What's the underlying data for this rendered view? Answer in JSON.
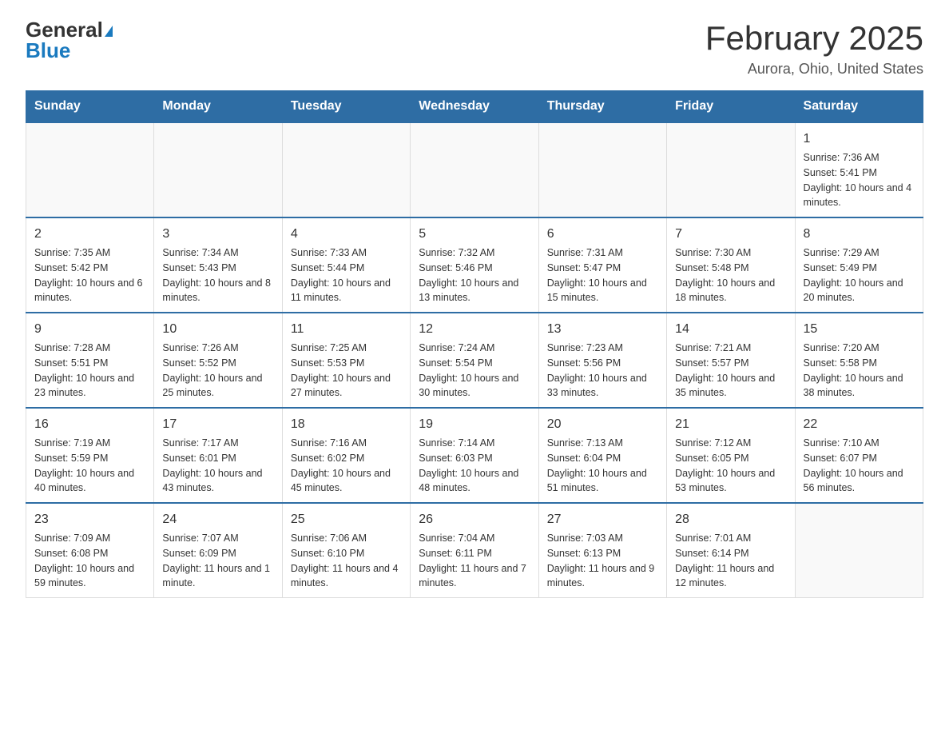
{
  "header": {
    "logo_general": "General",
    "logo_blue": "Blue",
    "month_title": "February 2025",
    "location": "Aurora, Ohio, United States"
  },
  "weekdays": [
    "Sunday",
    "Monday",
    "Tuesday",
    "Wednesday",
    "Thursday",
    "Friday",
    "Saturday"
  ],
  "weeks": [
    [
      {
        "day": "",
        "info": ""
      },
      {
        "day": "",
        "info": ""
      },
      {
        "day": "",
        "info": ""
      },
      {
        "day": "",
        "info": ""
      },
      {
        "day": "",
        "info": ""
      },
      {
        "day": "",
        "info": ""
      },
      {
        "day": "1",
        "info": "Sunrise: 7:36 AM\nSunset: 5:41 PM\nDaylight: 10 hours and 4 minutes."
      }
    ],
    [
      {
        "day": "2",
        "info": "Sunrise: 7:35 AM\nSunset: 5:42 PM\nDaylight: 10 hours and 6 minutes."
      },
      {
        "day": "3",
        "info": "Sunrise: 7:34 AM\nSunset: 5:43 PM\nDaylight: 10 hours and 8 minutes."
      },
      {
        "day": "4",
        "info": "Sunrise: 7:33 AM\nSunset: 5:44 PM\nDaylight: 10 hours and 11 minutes."
      },
      {
        "day": "5",
        "info": "Sunrise: 7:32 AM\nSunset: 5:46 PM\nDaylight: 10 hours and 13 minutes."
      },
      {
        "day": "6",
        "info": "Sunrise: 7:31 AM\nSunset: 5:47 PM\nDaylight: 10 hours and 15 minutes."
      },
      {
        "day": "7",
        "info": "Sunrise: 7:30 AM\nSunset: 5:48 PM\nDaylight: 10 hours and 18 minutes."
      },
      {
        "day": "8",
        "info": "Sunrise: 7:29 AM\nSunset: 5:49 PM\nDaylight: 10 hours and 20 minutes."
      }
    ],
    [
      {
        "day": "9",
        "info": "Sunrise: 7:28 AM\nSunset: 5:51 PM\nDaylight: 10 hours and 23 minutes."
      },
      {
        "day": "10",
        "info": "Sunrise: 7:26 AM\nSunset: 5:52 PM\nDaylight: 10 hours and 25 minutes."
      },
      {
        "day": "11",
        "info": "Sunrise: 7:25 AM\nSunset: 5:53 PM\nDaylight: 10 hours and 27 minutes."
      },
      {
        "day": "12",
        "info": "Sunrise: 7:24 AM\nSunset: 5:54 PM\nDaylight: 10 hours and 30 minutes."
      },
      {
        "day": "13",
        "info": "Sunrise: 7:23 AM\nSunset: 5:56 PM\nDaylight: 10 hours and 33 minutes."
      },
      {
        "day": "14",
        "info": "Sunrise: 7:21 AM\nSunset: 5:57 PM\nDaylight: 10 hours and 35 minutes."
      },
      {
        "day": "15",
        "info": "Sunrise: 7:20 AM\nSunset: 5:58 PM\nDaylight: 10 hours and 38 minutes."
      }
    ],
    [
      {
        "day": "16",
        "info": "Sunrise: 7:19 AM\nSunset: 5:59 PM\nDaylight: 10 hours and 40 minutes."
      },
      {
        "day": "17",
        "info": "Sunrise: 7:17 AM\nSunset: 6:01 PM\nDaylight: 10 hours and 43 minutes."
      },
      {
        "day": "18",
        "info": "Sunrise: 7:16 AM\nSunset: 6:02 PM\nDaylight: 10 hours and 45 minutes."
      },
      {
        "day": "19",
        "info": "Sunrise: 7:14 AM\nSunset: 6:03 PM\nDaylight: 10 hours and 48 minutes."
      },
      {
        "day": "20",
        "info": "Sunrise: 7:13 AM\nSunset: 6:04 PM\nDaylight: 10 hours and 51 minutes."
      },
      {
        "day": "21",
        "info": "Sunrise: 7:12 AM\nSunset: 6:05 PM\nDaylight: 10 hours and 53 minutes."
      },
      {
        "day": "22",
        "info": "Sunrise: 7:10 AM\nSunset: 6:07 PM\nDaylight: 10 hours and 56 minutes."
      }
    ],
    [
      {
        "day": "23",
        "info": "Sunrise: 7:09 AM\nSunset: 6:08 PM\nDaylight: 10 hours and 59 minutes."
      },
      {
        "day": "24",
        "info": "Sunrise: 7:07 AM\nSunset: 6:09 PM\nDaylight: 11 hours and 1 minute."
      },
      {
        "day": "25",
        "info": "Sunrise: 7:06 AM\nSunset: 6:10 PM\nDaylight: 11 hours and 4 minutes."
      },
      {
        "day": "26",
        "info": "Sunrise: 7:04 AM\nSunset: 6:11 PM\nDaylight: 11 hours and 7 minutes."
      },
      {
        "day": "27",
        "info": "Sunrise: 7:03 AM\nSunset: 6:13 PM\nDaylight: 11 hours and 9 minutes."
      },
      {
        "day": "28",
        "info": "Sunrise: 7:01 AM\nSunset: 6:14 PM\nDaylight: 11 hours and 12 minutes."
      },
      {
        "day": "",
        "info": ""
      }
    ]
  ]
}
